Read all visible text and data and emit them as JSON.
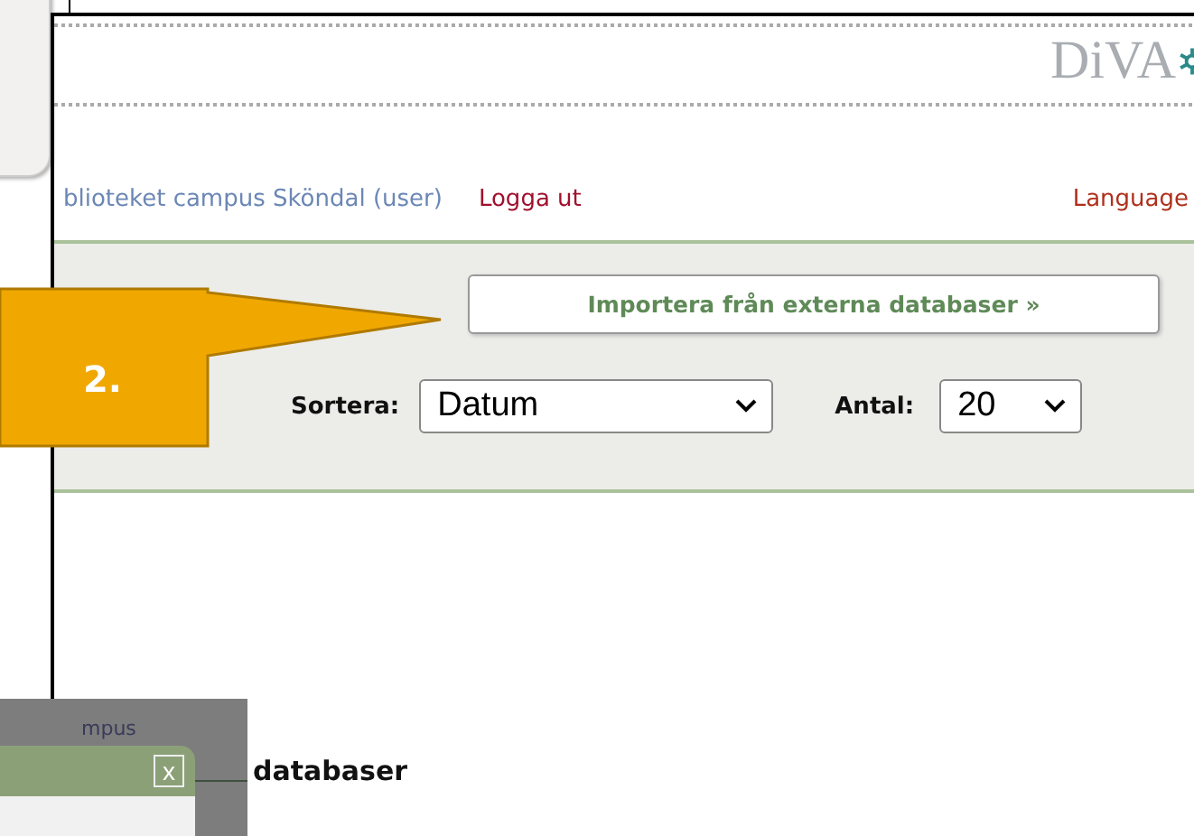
{
  "header": {
    "logo": "DiVA"
  },
  "nav": {
    "user": "blioteket campus Sköndal (user)",
    "logout": "Logga ut",
    "language": "Language"
  },
  "toolbar": {
    "import_button": "Importera från externa databaser »",
    "sort": {
      "label": "Sortera:",
      "value": "Datum"
    },
    "count": {
      "label": "Antal:",
      "value": "20"
    }
  },
  "callout": {
    "label": "2."
  },
  "dialog": {
    "close": "x",
    "background_text": "mpus",
    "heading": "databaser"
  }
}
